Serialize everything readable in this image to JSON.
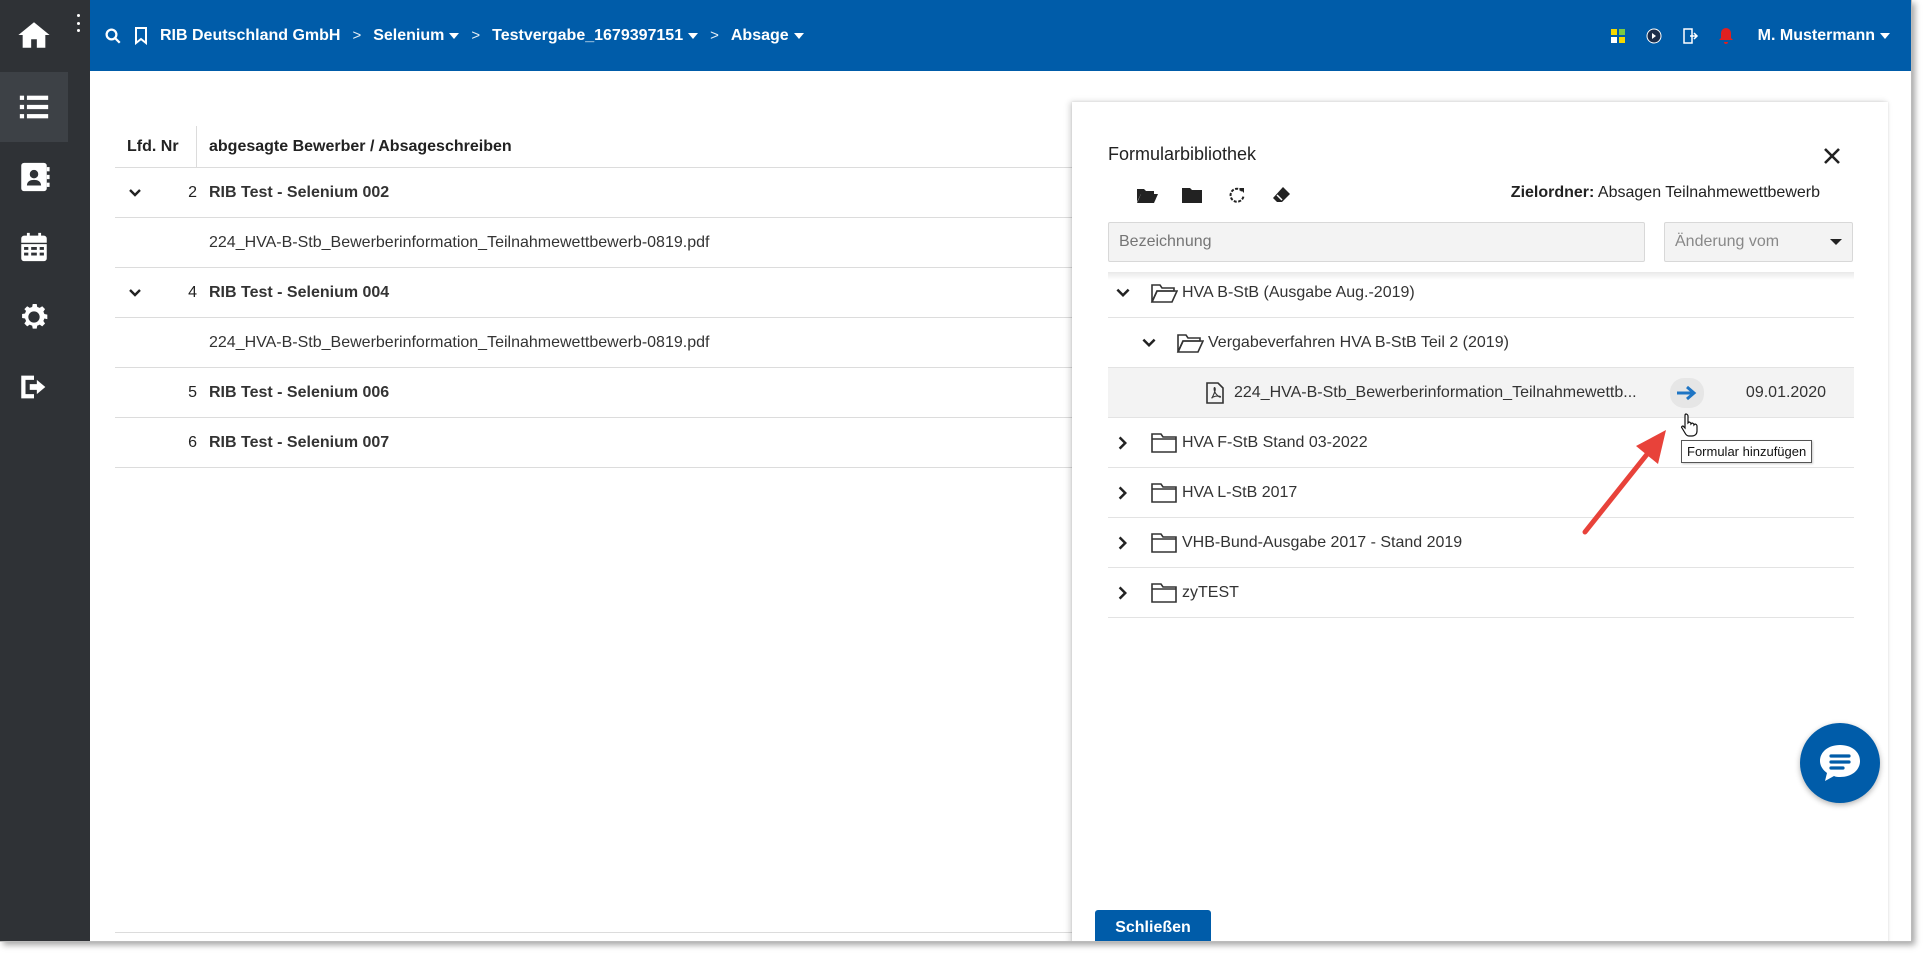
{
  "breadcrumb": {
    "items": [
      {
        "label": "RIB Deutschland GmbH",
        "has_dropdown": false
      },
      {
        "label": "Selenium",
        "has_dropdown": true
      },
      {
        "label": "Testvergabe_1679397151",
        "has_dropdown": true
      },
      {
        "label": "Absage",
        "has_dropdown": true
      }
    ]
  },
  "header": {
    "user": "M. Mustermann",
    "colors": {
      "bar": "#005ca9",
      "sidebar": "#2f3236"
    }
  },
  "sidebar": {
    "icons": [
      "home-icon",
      "list-icon",
      "address-book-icon",
      "calendar-icon",
      "gear-icon",
      "logout-icon"
    ]
  },
  "table": {
    "col_nr": "Lfd. Nr",
    "col_name": "abgesagte Bewerber / Absageschreiben",
    "rows": [
      {
        "type": "group",
        "num": "2",
        "label": "RIB Test - Selenium 002",
        "expandable": true
      },
      {
        "type": "file",
        "num": "",
        "label": "224_HVA-B-Stb_Bewerberinformation_Teilnahmewettbewerb-0819.pdf"
      },
      {
        "type": "group",
        "num": "4",
        "label": "RIB Test - Selenium 004",
        "expandable": true
      },
      {
        "type": "file",
        "num": "",
        "label": "224_HVA-B-Stb_Bewerberinformation_Teilnahmewettbewerb-0819.pdf"
      },
      {
        "type": "group",
        "num": "5",
        "label": "RIB Test - Selenium 006",
        "expandable": false
      },
      {
        "type": "group",
        "num": "6",
        "label": "RIB Test - Selenium 007",
        "expandable": false
      }
    ]
  },
  "panel": {
    "title": "Formularbibliothek",
    "target_label": "Zielordner:",
    "target_value": "Absagen Teilnahmewettbewerb",
    "search_placeholder": "Bezeichnung",
    "sort_label": "Änderung vom",
    "tree": [
      {
        "label": "HVA B-StB (Ausgabe Aug.-2019)",
        "level": 0,
        "kind": "folder-open",
        "expanded": true
      },
      {
        "label": "Vergabeverfahren HVA B-StB Teil 2 (2019)",
        "level": 1,
        "kind": "folder-open",
        "expanded": true
      },
      {
        "label": "224_HVA-B-Stb_Bewerberinformation_Teilnahmewettb...",
        "level": 2,
        "kind": "pdf",
        "date": "09.01.2020"
      },
      {
        "label": "HVA F-StB Stand 03-2022",
        "level": 0,
        "kind": "folder",
        "expanded": false
      },
      {
        "label": "HVA L-StB 2017",
        "level": 0,
        "kind": "folder",
        "expanded": false
      },
      {
        "label": "VHB-Bund-Ausgabe 2017 - Stand 2019",
        "level": 0,
        "kind": "folder",
        "expanded": false
      },
      {
        "label": "zyTEST",
        "level": 0,
        "kind": "folder",
        "expanded": false
      }
    ],
    "tooltip": "Formular hinzufügen",
    "close_button": "Schließen"
  }
}
